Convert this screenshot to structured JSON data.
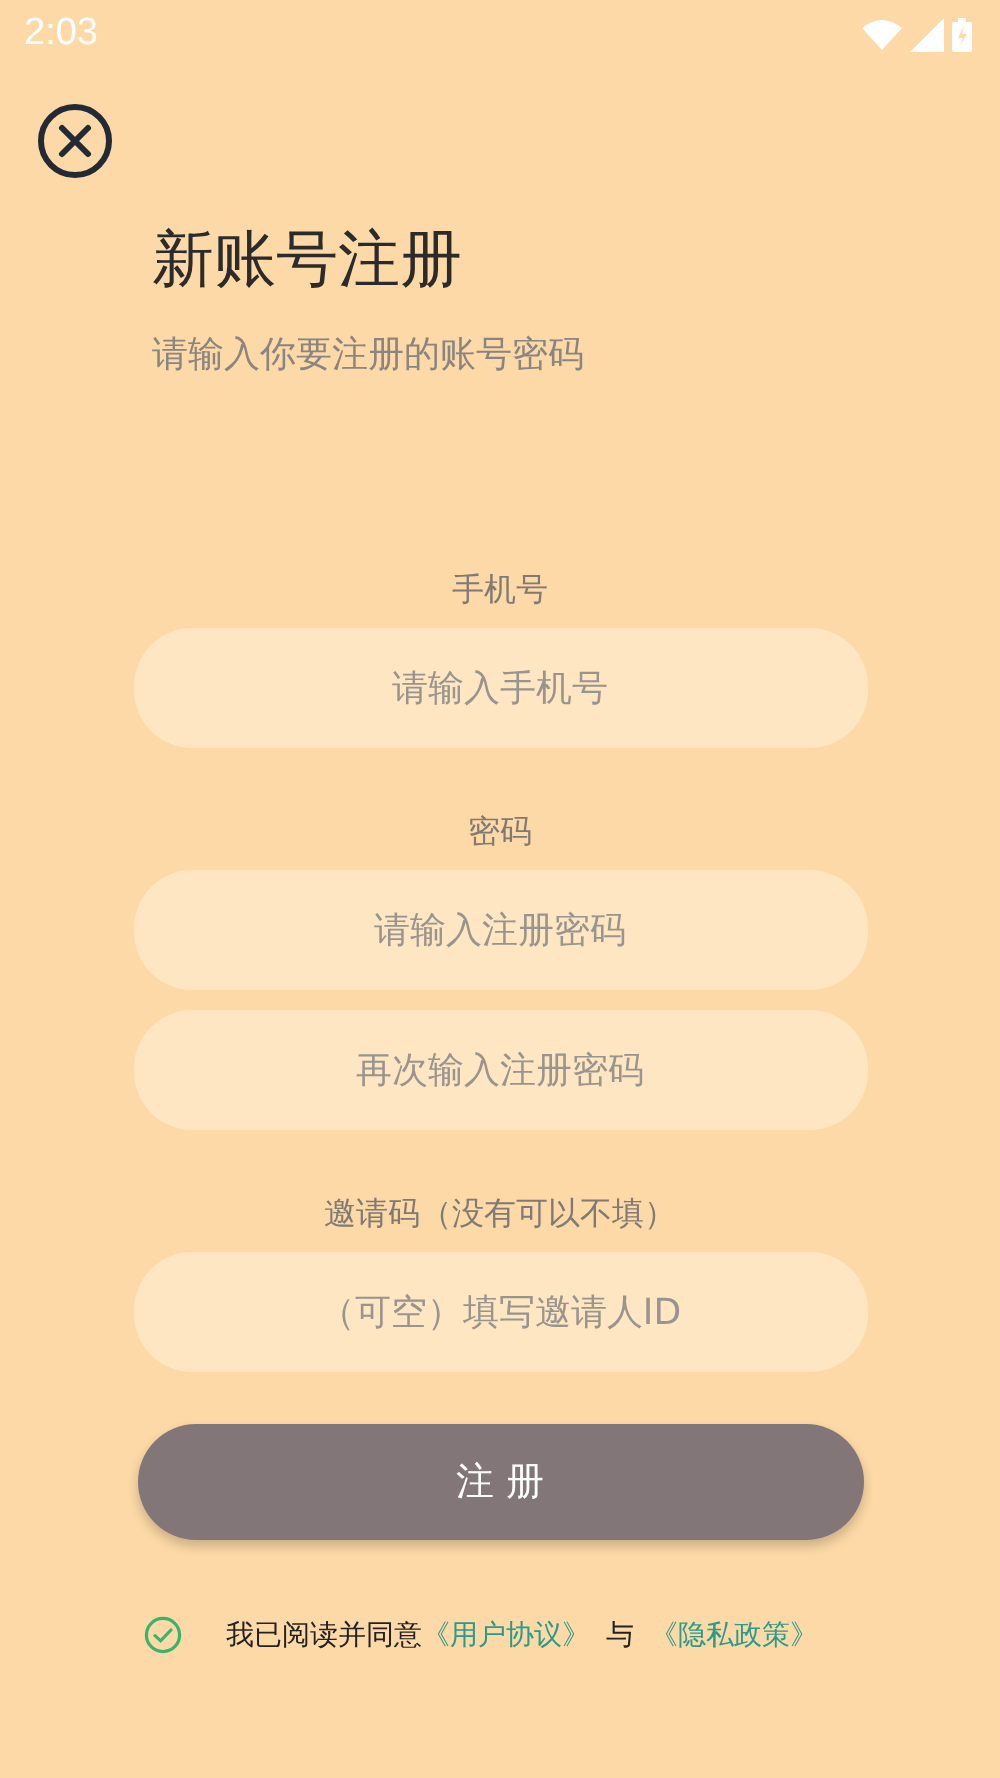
{
  "status_bar": {
    "time": "2:03"
  },
  "title": "新账号注册",
  "subtitle": "请输入你要注册的账号密码",
  "sections": [
    {
      "label": "手机号",
      "fields": [
        {
          "placeholder": "请输入手机号"
        }
      ]
    },
    {
      "label": "密码",
      "fields": [
        {
          "placeholder": "请输入注册密码"
        },
        {
          "placeholder": "再次输入注册密码"
        }
      ]
    },
    {
      "label": "邀请码（没有可以不填）",
      "fields": [
        {
          "placeholder": "（可空）填写邀请人ID"
        }
      ]
    }
  ],
  "submit_button": "注 册",
  "agreement": {
    "checked": true,
    "text": "我已阅读并同意",
    "link_1": "《用户协议》",
    "conjunction": "与",
    "link_2": "《隐私政策》"
  }
}
